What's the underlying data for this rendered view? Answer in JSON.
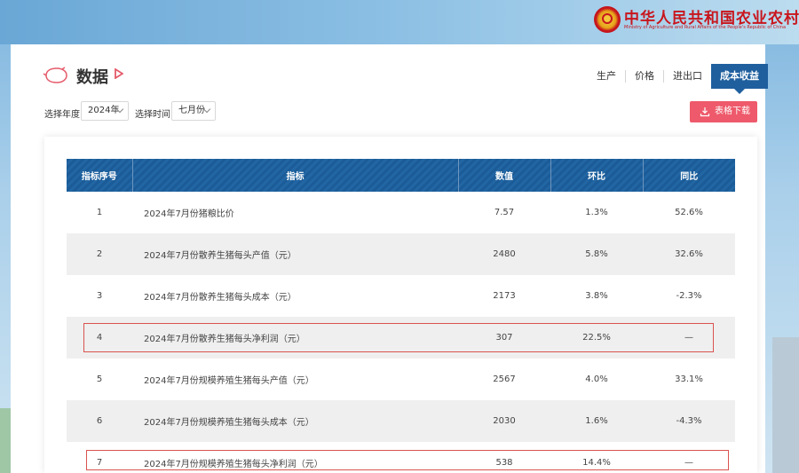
{
  "header": {
    "ministry_name_cn": "中华人民共和国农业农村部",
    "ministry_name_en": "Ministry of Agriculture and Rural Affairs of the People's Republic of China"
  },
  "page": {
    "title": "数据"
  },
  "tabs": [
    {
      "label": "生产",
      "active": false
    },
    {
      "label": "价格",
      "active": false
    },
    {
      "label": "进出口",
      "active": false
    },
    {
      "label": "成本收益",
      "active": true
    }
  ],
  "filters": {
    "year_label": "选择年度：",
    "year_value": "2024年",
    "time_label": "选择时间：",
    "time_value": "七月份"
  },
  "download_button": {
    "label": "表格下载"
  },
  "table": {
    "headers": [
      "指标序号",
      "指标",
      "数值",
      "环比",
      "同比"
    ],
    "rows": [
      {
        "index": "1",
        "name": "2024年7月份猪粮比价",
        "value": "7.57",
        "mom": "1.3%",
        "yoy": "52.6%"
      },
      {
        "index": "2",
        "name": "2024年7月份散养生猪每头产值（元）",
        "value": "2480",
        "mom": "5.8%",
        "yoy": "32.6%"
      },
      {
        "index": "3",
        "name": "2024年7月份散养生猪每头成本（元）",
        "value": "2173",
        "mom": "3.8%",
        "yoy": "-2.3%"
      },
      {
        "index": "4",
        "name": "2024年7月份散养生猪每头净利润（元）",
        "value": "307",
        "mom": "22.5%",
        "yoy": "—"
      },
      {
        "index": "5",
        "name": "2024年7月份规模养殖生猪每头产值（元）",
        "value": "2567",
        "mom": "4.0%",
        "yoy": "33.1%"
      },
      {
        "index": "6",
        "name": "2024年7月份规模养殖生猪每头成本（元）",
        "value": "2030",
        "mom": "1.6%",
        "yoy": "-4.3%"
      },
      {
        "index": "7",
        "name": "2024年7月份规模养殖生猪每头净利润（元）",
        "value": "538",
        "mom": "14.4%",
        "yoy": "—"
      }
    ]
  },
  "colors": {
    "accent_blue": "#1f5f9e",
    "download_red": "#ee5a6b",
    "ministry_red": "#c8161d",
    "highlight_red": "#d9534f"
  },
  "icons": {
    "emblem": "national-emblem-icon",
    "title": "pig-outline-icon",
    "title_arrow": "play-arrow-icon",
    "download": "download-icon"
  }
}
